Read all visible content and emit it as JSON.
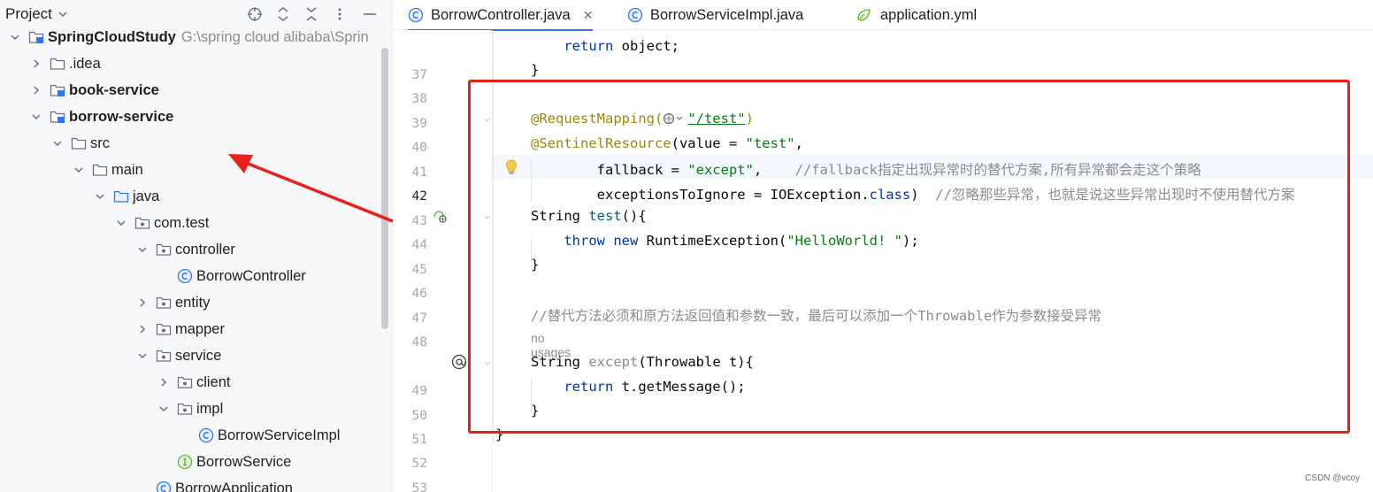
{
  "project_panel": {
    "title": "Project",
    "icons": [
      "crosshair-icon",
      "expand-icon",
      "collapse-icon",
      "more-icon",
      "minimize-icon"
    ],
    "tree": [
      {
        "label": "SpringCloudStudy",
        "hint": "G:\\spring cloud alibaba\\Sprin",
        "bold": true,
        "depth": 0,
        "chevron": "down",
        "icon": "module-folder-icon"
      },
      {
        "label": ".idea",
        "bold": false,
        "depth": 1,
        "chevron": "right",
        "icon": "folder-icon"
      },
      {
        "label": "book-service",
        "bold": true,
        "depth": 1,
        "chevron": "right",
        "icon": "module-folder-icon"
      },
      {
        "label": "borrow-service",
        "bold": true,
        "depth": 1,
        "chevron": "down",
        "icon": "module-folder-icon"
      },
      {
        "label": "src",
        "bold": false,
        "depth": 2,
        "chevron": "down",
        "icon": "folder-icon"
      },
      {
        "label": "main",
        "bold": false,
        "depth": 3,
        "chevron": "down",
        "icon": "folder-icon"
      },
      {
        "label": "java",
        "bold": false,
        "depth": 4,
        "chevron": "down",
        "icon": "source-folder-icon"
      },
      {
        "label": "com.test",
        "bold": false,
        "depth": 5,
        "chevron": "down",
        "icon": "package-icon"
      },
      {
        "label": "controller",
        "bold": false,
        "depth": 6,
        "chevron": "down",
        "icon": "package-icon"
      },
      {
        "label": "BorrowController",
        "bold": false,
        "depth": 7,
        "chevron": "none",
        "icon": "class-icon"
      },
      {
        "label": "entity",
        "bold": false,
        "depth": 6,
        "chevron": "right",
        "icon": "package-icon"
      },
      {
        "label": "mapper",
        "bold": false,
        "depth": 6,
        "chevron": "right",
        "icon": "package-icon"
      },
      {
        "label": "service",
        "bold": false,
        "depth": 6,
        "chevron": "down",
        "icon": "package-icon"
      },
      {
        "label": "client",
        "bold": false,
        "depth": 7,
        "chevron": "right",
        "icon": "package-icon"
      },
      {
        "label": "impl",
        "bold": false,
        "depth": 7,
        "chevron": "down",
        "icon": "package-icon"
      },
      {
        "label": "BorrowServiceImpl",
        "bold": false,
        "depth": 8,
        "chevron": "none",
        "icon": "class-icon"
      },
      {
        "label": "BorrowService",
        "bold": false,
        "depth": 7,
        "chevron": "none",
        "icon": "interface-icon"
      },
      {
        "label": "BorrowApplication",
        "bold": false,
        "depth": 6,
        "chevron": "none",
        "icon": "spring-class-icon"
      }
    ]
  },
  "tabs": [
    {
      "label": "BorrowController.java",
      "icon": "class-icon",
      "active": true,
      "closable": true
    },
    {
      "label": "BorrowServiceImpl.java",
      "icon": "class-icon",
      "active": false,
      "closable": false
    },
    {
      "label": "application.yml",
      "icon": "yaml-leaf-icon",
      "active": false,
      "closable": false
    }
  ],
  "editor": {
    "current_line": "42",
    "line_numbers": [
      "37",
      "38",
      "39",
      "40",
      "41",
      "42",
      "43",
      "44",
      "45",
      "46",
      "47",
      "48",
      "",
      "49",
      "50",
      "51",
      "52",
      "53"
    ],
    "no_usages_hint": "no usages",
    "code": {
      "l37_kw": "return",
      "l37_rest": " object;",
      "l38": "}",
      "l40_ann": "@RequestMapping(",
      "l40_url": "\"/test\"",
      "l40_close": ")",
      "l41_ann": "@SentinelResource",
      "l41_a": "(value = ",
      "l41_str": "\"test\"",
      "l41_b": ",",
      "l42_a": "fallback = ",
      "l42_str": "\"except\"",
      "l42_b": ",    ",
      "l42_cmt": "//fallback指定出现异常时的替代方案,所有异常都会走这个策略",
      "l43_a": "exceptionsToIgnore = IOException.",
      "l43_kw": "class",
      "l43_b": ")  ",
      "l43_cmt": "//忽略那些异常，也就是说这些异常出现时不使用替代方案",
      "l44_a": "String ",
      "l44_fn": "test",
      "l44_b": "(){",
      "l45_kw1": "throw",
      "l45_sp": " ",
      "l45_kw2": "new",
      "l45_a": " RuntimeException(",
      "l45_str": "\"HelloWorld! \"",
      "l45_b": ");",
      "l46": "}",
      "l48_cmt": "//替代方法必须和原方法返回值和参数一致，最后可以添加一个Throwable作为参数接受异常",
      "l49_a": "String ",
      "l49_fn": "except",
      "l49_b": "(Throwable t){",
      "l50_kw": "return",
      "l50_rest": " t.getMessage();",
      "l51": "}",
      "l52": "}"
    }
  },
  "watermark": "CSDN @vcoy",
  "colors": {
    "annotation_box": "#e8201c",
    "arrow": "#e8201c",
    "accent": "#3574f0"
  }
}
